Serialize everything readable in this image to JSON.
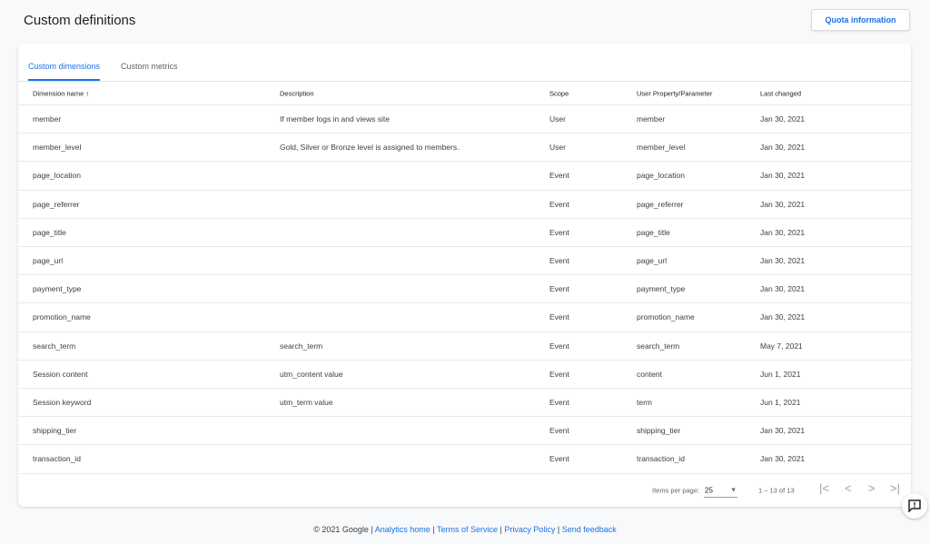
{
  "header": {
    "title": "Custom definitions",
    "quota_button": "Quota information"
  },
  "tabs": [
    {
      "label": "Custom dimensions",
      "active": true
    },
    {
      "label": "Custom metrics",
      "active": false
    }
  ],
  "table": {
    "columns": [
      "Dimension name",
      "Description",
      "Scope",
      "User Property/Parameter",
      "Last changed"
    ],
    "sort_icon": "arrow-up-icon",
    "rows": [
      [
        "member",
        "If member logs in and views site",
        "User",
        "member",
        "Jan 30, 2021"
      ],
      [
        "member_level",
        "Gold, Silver or Bronze level is assigned to members.",
        "User",
        "member_level",
        "Jan 30, 2021"
      ],
      [
        "page_location",
        "",
        "Event",
        "page_location",
        "Jan 30, 2021"
      ],
      [
        "page_referrer",
        "",
        "Event",
        "page_referrer",
        "Jan 30, 2021"
      ],
      [
        "page_title",
        "",
        "Event",
        "page_title",
        "Jan 30, 2021"
      ],
      [
        "page_url",
        "",
        "Event",
        "page_url",
        "Jan 30, 2021"
      ],
      [
        "payment_type",
        "",
        "Event",
        "payment_type",
        "Jan 30, 2021"
      ],
      [
        "promotion_name",
        "",
        "Event",
        "promotion_name",
        "Jan 30, 2021"
      ],
      [
        "search_term",
        "search_term",
        "Event",
        "search_term",
        "May 7, 2021"
      ],
      [
        "Session content",
        "utm_content value",
        "Event",
        "content",
        "Jun 1, 2021"
      ],
      [
        "Session keyword",
        "utm_term value",
        "Event",
        "term",
        "Jun 1, 2021"
      ],
      [
        "shipping_tier",
        "",
        "Event",
        "shipping_tier",
        "Jan 30, 2021"
      ],
      [
        "transaction_id",
        "",
        "Event",
        "transaction_id",
        "Jan 30, 2021"
      ]
    ]
  },
  "pagination": {
    "items_label": "Items per page:",
    "items_value": "25",
    "range": "1 – 13 of 13"
  },
  "footer": {
    "copyright": "© 2021 Google |",
    "links": [
      "Analytics home",
      "Terms of Service",
      "Privacy Policy",
      "Send feedback"
    ]
  }
}
